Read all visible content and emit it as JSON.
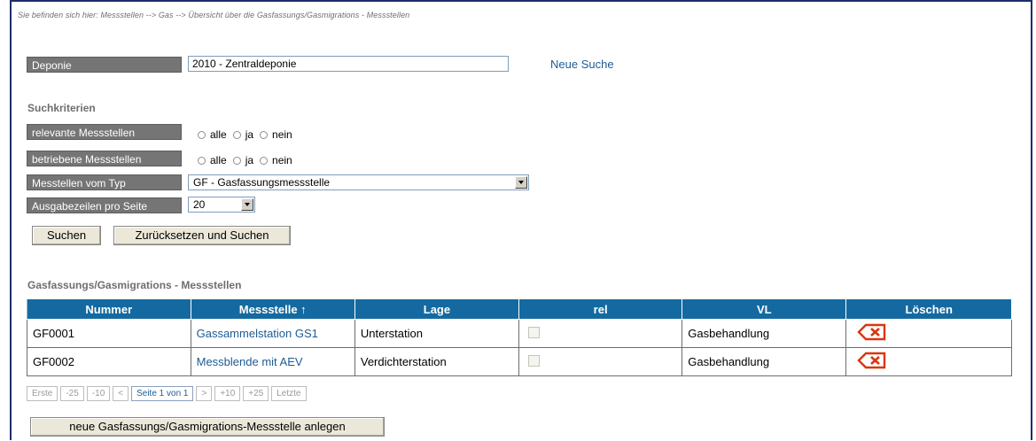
{
  "breadcrumb": "Sie befinden sich hier: Messstellen --> Gas --> Übersicht über die Gasfassungs/Gasmigrations - Messstellen",
  "deponie": {
    "label": "Deponie",
    "value": "2010 - Zentraldeponie",
    "new_search": "Neue Suche"
  },
  "criteria": {
    "heading": "Suchkriterien",
    "relevant": {
      "label": "relevante Messstellen",
      "options": [
        "alle",
        "ja",
        "nein"
      ]
    },
    "betrieben": {
      "label": "betriebene Messstellen",
      "options": [
        "alle",
        "ja",
        "nein"
      ]
    },
    "typ": {
      "label": "Messtellen vom Typ",
      "value": "GF - Gasfassungsmessstelle"
    },
    "rows": {
      "label": "Ausgabezeilen pro Seite",
      "value": "20"
    },
    "search_button": "Suchen",
    "reset_button": "Zurücksetzen und Suchen"
  },
  "results": {
    "heading": "Gasfassungs/Gasmigrations - Messstellen",
    "columns": [
      "Nummer",
      "Messstelle ↑",
      "Lage",
      "rel",
      "VL",
      "Löschen"
    ],
    "rows": [
      {
        "nummer": "GF0001",
        "messstelle": "Gassammelstation GS1",
        "lage": "Unterstation",
        "rel": false,
        "vl": "Gasbehandlung"
      },
      {
        "nummer": "GF0002",
        "messstelle": "Messblende mit AEV",
        "lage": "Verdichterstation",
        "rel": false,
        "vl": "Gasbehandlung"
      }
    ]
  },
  "pager": {
    "first": "Erste",
    "m25": "-25",
    "m10": "-10",
    "prev": "<",
    "current": "Seite 1 von 1",
    "next": ">",
    "p10": "+10",
    "p25": "+25",
    "last": "Letzte"
  },
  "create_button": "neue Gasfassungs/Gasmigrations-Messstelle anlegen",
  "colors": {
    "table_header": "#146aa0",
    "label_bg": "#757575",
    "link": "#1d5c96",
    "delete_icon": "#d9360f"
  },
  "icons": {
    "delete": "delete-x-icon"
  }
}
